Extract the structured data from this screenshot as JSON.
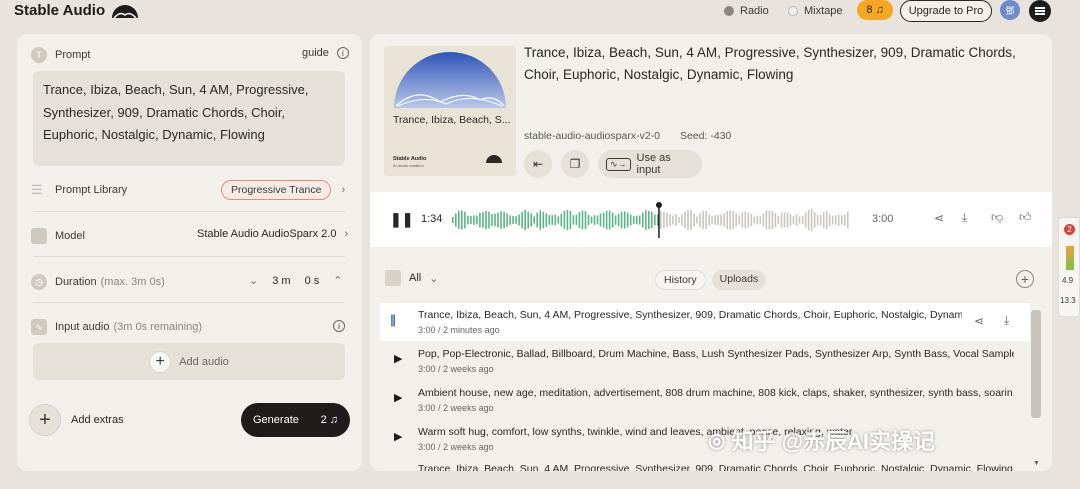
{
  "app": {
    "name": "Stable Audio"
  },
  "topnav": {
    "radio": "Radio",
    "mixtape": "Mixtape",
    "credits": "8",
    "upgrade": "Upgrade to Pro",
    "avatar": "鄧"
  },
  "left": {
    "prompt_label": "Prompt",
    "guide": "guide",
    "prompt_text": "Trance, Ibiza, Beach, Sun, 4 AM, Progressive, Synthesizer, 909, Dramatic Chords, Choir, Euphoric, Nostalgic, Dynamic, Flowing",
    "library_label": "Prompt Library",
    "library_tag": "Progressive Trance",
    "model_label": "Model",
    "model_value": "Stable Audio AudioSparx 2.0",
    "duration_label": "Duration",
    "duration_hint": "(max. 3m 0s)",
    "duration_min": "3 m",
    "duration_sec": "0 s",
    "input_audio_label": "Input audio",
    "input_audio_hint": "(3m 0s remaining)",
    "add_audio": "Add audio",
    "add_extras": "Add extras",
    "generate": "Generate",
    "generate_cost": "2"
  },
  "track": {
    "title": "Trance, Ibiza, Beach, Sun, 4 AM, Progressive, Synthesizer, 909, Dramatic Chords, Choir, Euphoric, Nostalgic, Dynamic, Flowing",
    "art_caption": "Trance, Ibiza, Beach, S...",
    "art_brand": "Stable Audio",
    "art_sub": "AI music creation",
    "model": "stable-audio-audiosparx-v2-0",
    "seed": "Seed: -430",
    "use_as_input": "Use as input"
  },
  "player": {
    "current": "1:34",
    "total": "3:00",
    "progress": 0.52
  },
  "list": {
    "filter": "All",
    "tab_history": "History",
    "tab_uploads": "Uploads",
    "rows": [
      {
        "title": "Trance, Ibiza, Beach, Sun, 4 AM, Progressive, Synthesizer, 909, Dramatic Chords, Choir, Euphoric, Nostalgic, Dynam...",
        "duration": "3:00",
        "ago": "2 minutes ago"
      },
      {
        "title": "Pop, Pop-Electronic, Ballad, Billboard, Drum Machine, Bass, Lush Synthesizer Pads, Synthesizer Arp, Synth Bass, Vocal Sample ...",
        "duration": "3:00",
        "ago": "2 weeks ago"
      },
      {
        "title": "Ambient house, new age, meditation, advertisement, 808 drum machine, 808 kick, claps, shaker, synthesizer, synth bass, soarin...",
        "duration": "3:00",
        "ago": "2 weeks ago"
      },
      {
        "title": "Warm soft hug, comfort, low synths, twinkle, wind and leaves, ambient, peace, relaxing, water",
        "duration": "3:00",
        "ago": "2 weeks ago"
      },
      {
        "title": "Trance, Ibiza, Beach, Sun, 4 AM, Progressive, Synthesizer, 909, Dramatic Chords, Choir, Euphoric, Nostalgic, Dynamic, Flowing",
        "duration": "",
        "ago": ""
      }
    ]
  },
  "side_widget": {
    "badge": "2",
    "v1": "4.9",
    "v2": "13.3"
  },
  "watermark": "知乎 @赤辰AI实操记"
}
